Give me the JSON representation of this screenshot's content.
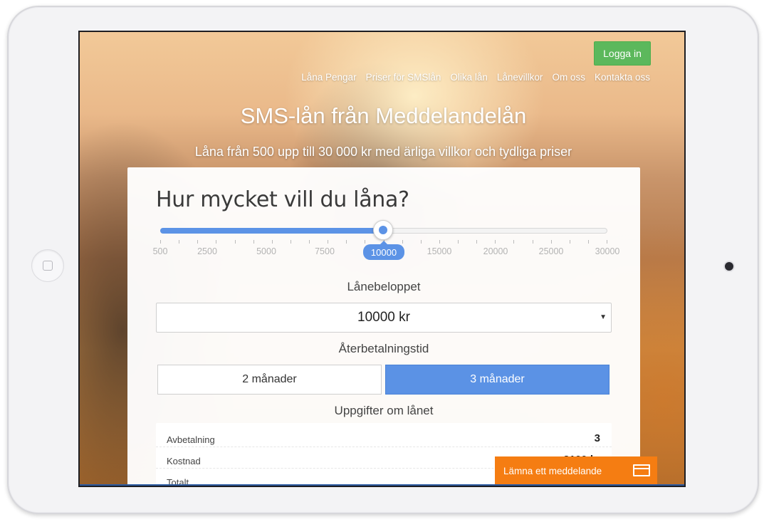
{
  "header": {
    "login_label": "Logga in",
    "nav": [
      "Låna Pengar",
      "Priser för SMSlån",
      "Olika lån",
      "Lånevillkor",
      "Om oss",
      "Kontakta oss"
    ]
  },
  "hero": {
    "title": "SMS-lån från Meddelandelån",
    "subtitle": "Låna från 500 upp till 30 000 kr med ärliga villkor och tydliga priser"
  },
  "calculator": {
    "title": "Hur mycket vill du låna?",
    "slider": {
      "value_label": "10000",
      "value_fraction": 0.5,
      "tick_labels": [
        "500",
        "2500",
        "5000",
        "7500",
        "15000",
        "20000",
        "25000",
        "30000"
      ]
    },
    "amount_label": "Lånebeloppet",
    "amount_value": "10000 kr",
    "term_label": "Återbetalningstid",
    "term_options": [
      "2 månader",
      "3 månader"
    ],
    "term_selected": "3 månader",
    "details_label": "Uppgifter om lånet",
    "details": [
      {
        "key": "Avbetalning",
        "value": "3"
      },
      {
        "key": "Kostnad",
        "value": "2100 kr"
      },
      {
        "key": "Totalt",
        "value": ""
      }
    ]
  },
  "chat": {
    "label": "Lämna ett meddelande"
  },
  "colors": {
    "accent": "#5c93e6",
    "login": "#5cb85c",
    "chat": "#f57d12"
  }
}
